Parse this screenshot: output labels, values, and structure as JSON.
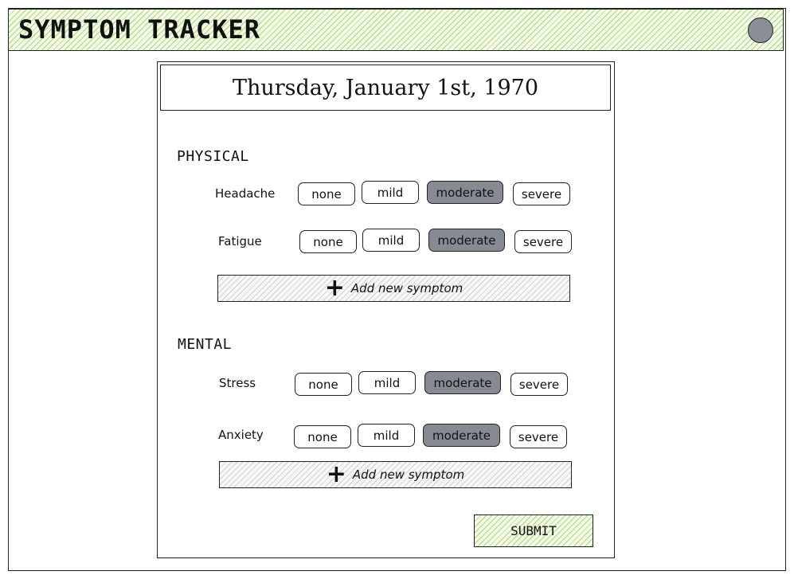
{
  "app": {
    "title": "SYMPTOM TRACKER",
    "avatar_icon": "user-avatar-circle",
    "accent_color": "#a6d874",
    "selected_color": "#868b93"
  },
  "date": "Thursday, January 1st, 1970",
  "sections": [
    {
      "title": "PHYSICAL",
      "symptoms": [
        {
          "label": "Headache",
          "selected": "moderate"
        },
        {
          "label": "Fatigue",
          "selected": "moderate"
        }
      ],
      "add_label": "Add new symptom"
    },
    {
      "title": "MENTAL",
      "symptoms": [
        {
          "label": "Stress",
          "selected": "moderate"
        },
        {
          "label": "Anxiety",
          "selected": "moderate"
        }
      ],
      "add_label": "Add new symptom"
    }
  ],
  "severity_options": [
    "none",
    "mild",
    "moderate",
    "severe"
  ],
  "add_icon": "plus-icon",
  "submit_label": "SUBMIT"
}
